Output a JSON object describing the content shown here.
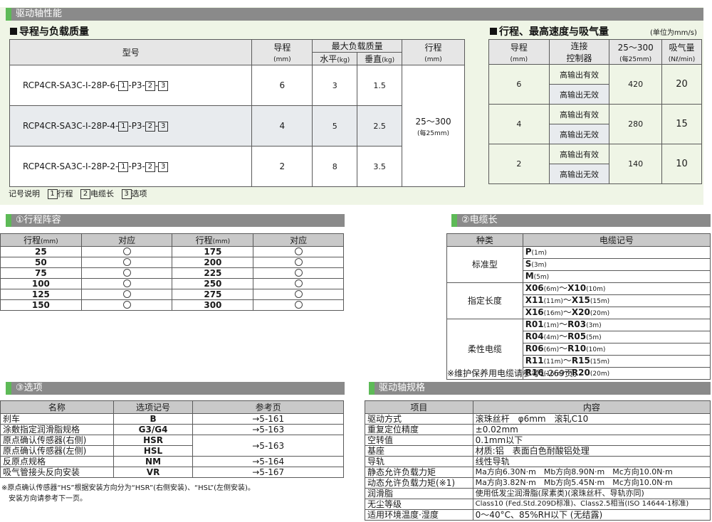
{
  "header_bar": {
    "title": "驱动轴性能"
  },
  "lead_payload": {
    "title": "导程与负载质量",
    "col_model": "型号",
    "col_lead": "导程",
    "col_lead_unit": "(mm)",
    "col_max_load": "最大负载质量",
    "col_horizontal": "水平",
    "col_vertical": "垂直",
    "unit_kg": "(kg)",
    "col_stroke": "行程",
    "col_stroke_unit": "(mm)",
    "stroke_value": "25～300",
    "stroke_pitch": "(每25mm)",
    "model_mid": "-P3-",
    "model_dash": "-",
    "box1": "1",
    "box2": "2",
    "box3": "3",
    "rows": [
      {
        "model": "RCP4CR-SA3C-I-28P-6-",
        "lead": "6",
        "horizontal": "3",
        "vertical": "1.5"
      },
      {
        "model": "RCP4CR-SA3C-I-28P-4-",
        "lead": "4",
        "horizontal": "5",
        "vertical": "2.5"
      },
      {
        "model": "RCP4CR-SA3C-I-28P-2-",
        "lead": "2",
        "horizontal": "8",
        "vertical": "3.5"
      }
    ],
    "legend_label": "记号说明",
    "legend_1": "行程",
    "legend_2": "电缆长",
    "legend_3": "选项"
  },
  "speed_table": {
    "title": "行程、最高速度与吸气量",
    "unit_note": "(单位为mm/s)",
    "col_lead": "导程",
    "col_lead_unit": "(mm)",
    "col_controller_1": "连接",
    "col_controller_2": "控制器",
    "col_speed": "25～300",
    "col_speed_sub": "(每25mm)",
    "col_air": "吸气量",
    "col_air_unit": "(Nℓ/min)",
    "out_on": "高输出有效",
    "out_off": "高输出无效",
    "rows": [
      {
        "lead": "6",
        "speed": "420",
        "air": "20"
      },
      {
        "lead": "4",
        "speed": "280",
        "air": "15"
      },
      {
        "lead": "2",
        "speed": "140",
        "air": "10"
      }
    ]
  },
  "stroke_section": {
    "title": "①行程阵容",
    "col_stroke": "行程",
    "col_unit": "(mm)",
    "col_support": "对应",
    "left": [
      "25",
      "50",
      "75",
      "100",
      "125",
      "150"
    ],
    "right": [
      "175",
      "200",
      "225",
      "250",
      "275",
      "300"
    ]
  },
  "cable_section": {
    "title": "②电缆长",
    "col_type": "种类",
    "col_code": "电缆记号",
    "type_standard": "标准型",
    "type_specified": "指定长度",
    "type_flexible": "柔性电缆",
    "standard": [
      {
        "code": "P",
        "len": "(1m)"
      },
      {
        "code": "S",
        "len": "(3m)"
      },
      {
        "code": "M",
        "len": "(5m)"
      }
    ],
    "specified": [
      {
        "a": "X06",
        "al": "(6m)",
        "sep": "～",
        "b": "X10",
        "bl": "(10m)"
      },
      {
        "a": "X11",
        "al": "(11m)",
        "sep": "～",
        "b": "X15",
        "bl": "(15m)"
      },
      {
        "a": "X16",
        "al": "(16m)",
        "sep": "～",
        "b": "X20",
        "bl": "(20m)"
      }
    ],
    "flexible": [
      {
        "a": "R01",
        "al": "(1m)",
        "sep": "～",
        "b": "R03",
        "bl": "(3m)"
      },
      {
        "a": "R04",
        "al": "(4m)",
        "sep": "～",
        "b": "R05",
        "bl": "(5m)"
      },
      {
        "a": "R06",
        "al": "(6m)",
        "sep": "～",
        "b": "R10",
        "bl": "(10m)"
      },
      {
        "a": "R11",
        "al": "(11m)",
        "sep": "～",
        "b": "R15",
        "bl": "(15m)"
      },
      {
        "a": "R16",
        "al": "(16m)",
        "sep": "～",
        "b": "R20",
        "bl": "(20m)"
      }
    ],
    "note": "※维护保养用电缆请参考1-269页。"
  },
  "options_section": {
    "title": "③选项",
    "col_name": "名称",
    "col_code": "选项记号",
    "col_page": "参考页",
    "rows": [
      {
        "name": "刹车",
        "code": "B",
        "page": "→5-161"
      },
      {
        "name": "涂敷指定润滑脂规格",
        "code": "G3/G4",
        "page": "→5-163"
      },
      {
        "name": "原点确认传感器(右侧)",
        "code": "HSR",
        "page": "→5-163"
      },
      {
        "name": "原点确认传感器(左侧)",
        "code": "HSL",
        "page": ""
      },
      {
        "name": "反原点规格",
        "code": "NM",
        "page": "→5-164"
      },
      {
        "name": "吸气管接头反向安装",
        "code": "VR",
        "page": "→5-167"
      }
    ],
    "note_1": "※原点确认传感器“HS”根据安装方向分为“HSR”(右侧安装)、“HSL”(左侧安装)。",
    "note_2": "安装方向请参考下一页。"
  },
  "spec_section": {
    "title": "驱动轴规格",
    "col_item": "项目",
    "col_content": "内容",
    "rows": [
      {
        "item": "驱动方式",
        "content": "滚珠丝杆　φ6mm　滚轧C10"
      },
      {
        "item": "重复定位精度",
        "content": "±0.02mm"
      },
      {
        "item": "空转值",
        "content": "0.1mm以下"
      },
      {
        "item": "基座",
        "content": "材质:铝　表面白色耐酸铝处理"
      },
      {
        "item": "导轨",
        "content": "线性导轨"
      },
      {
        "item": "静态允许负载力矩",
        "content": "Ma方向6.30N·m　Mb方向8.90N·m　Mc方向10.0N·m"
      },
      {
        "item": "动态允许负载力矩(※1)",
        "content": "Ma方向3.82N·m　Mb方向5.45N·m　Mc方向10.0N·m"
      },
      {
        "item": "润滑脂",
        "content": "使用低发尘润滑脂(尿素类)(滚珠丝杆、导轨亦同)"
      },
      {
        "item": "无尘等级",
        "content": "Class10 (Fed.Std.209D标准)、Class2.5相当(ISO 14644-1标准)"
      },
      {
        "item": "适用环境温度·湿度",
        "content": "0～40°C、85%RH以下 (无结露)"
      }
    ]
  }
}
